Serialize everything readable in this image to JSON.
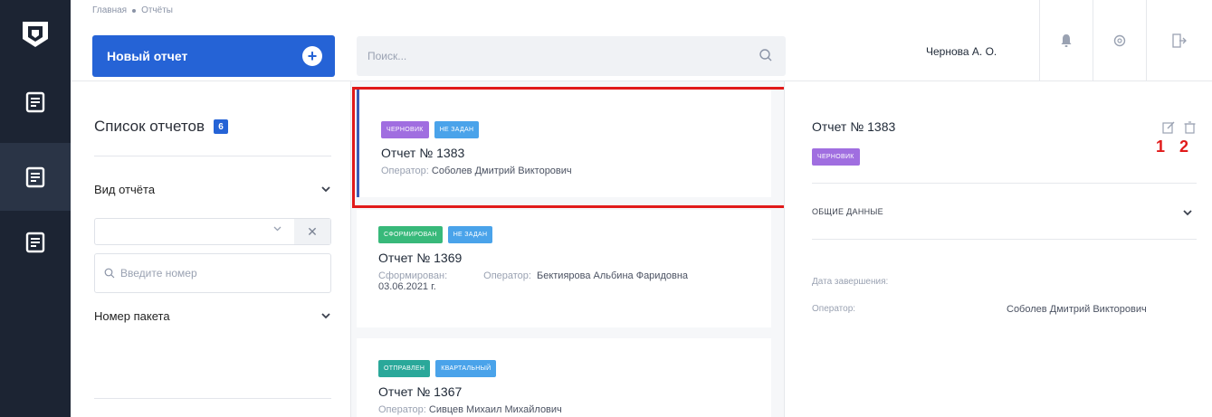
{
  "header": {
    "breadcrumb": [
      "Главная",
      "Отчёты"
    ],
    "new_report_label": "Новый отчет",
    "search_placeholder": "Поиск...",
    "user_name": "Чернова А. О."
  },
  "filters": {
    "title": "Список отчетов",
    "count": "6",
    "report_type_label": "Вид отчёта",
    "batch_number_label": "Номер пакета",
    "batch_number_placeholder": "Введите номер"
  },
  "reports": [
    {
      "tags": [
        {
          "label": "ЧЕРНОВИК",
          "color": "#a06ee0"
        },
        {
          "label": "НЕ ЗАДАН",
          "color": "#4aa3ea"
        }
      ],
      "title": "Отчет № 1383",
      "operator_label": "Оператор:",
      "operator": "Соболев Дмитрий Викторович"
    },
    {
      "tags": [
        {
          "label": "СФОРМИРОВАН",
          "color": "#38b97a"
        },
        {
          "label": "НЕ ЗАДАН",
          "color": "#4aa3ea"
        }
      ],
      "title": "Отчет № 1369",
      "formed_label": "Сформирован:",
      "formed_date": "03.06.2021 г.",
      "operator_label": "Оператор:",
      "operator": "Бектиярова Альбина Фаридовна"
    },
    {
      "tags": [
        {
          "label": "ОТПРАВЛЕН",
          "color": "#2aa89a"
        },
        {
          "label": "КВАРТАЛЬНЫЙ",
          "color": "#4aa3ea"
        }
      ],
      "title": "Отчет № 1367",
      "operator_label": "Оператор:",
      "operator": "Сивцев Михаил Михайлович"
    }
  ],
  "detail": {
    "title": "Отчет № 1383",
    "status_tag": "ЧЕРНОВИК",
    "status_color": "#a06ee0",
    "section_title": "ОБЩИЕ ДАННЫЕ",
    "completion_label": "Дата завершения:",
    "operator_label": "Оператор:",
    "operator_value": "Соболев Дмитрий Викторович",
    "annotation_1": "1",
    "annotation_2": "2"
  },
  "colors": {
    "accent": "#2563d6",
    "rail": "#1c2433",
    "highlight": "#e11a1a"
  }
}
